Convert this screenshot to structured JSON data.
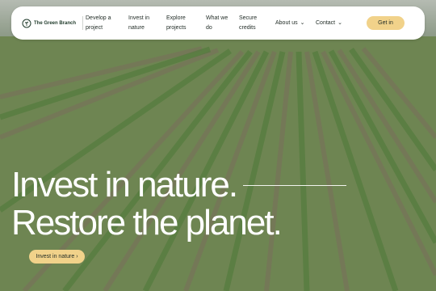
{
  "nav": {
    "brand": "The Green Branch",
    "items": [
      {
        "line1": "Develop a",
        "line2": "project"
      },
      {
        "line1": "Invest in",
        "line2": "nature"
      },
      {
        "line1": "Explore",
        "line2": "projects"
      },
      {
        "line1": "What we",
        "line2": "do"
      },
      {
        "line1": "Secure",
        "line2": "credits"
      }
    ],
    "about": "About us",
    "contact": "Contact",
    "cta": "Get in"
  },
  "hero": {
    "line1": "Invest in nature.",
    "line2": "Restore the planet.",
    "button": "Invest in nature ›"
  },
  "colors": {
    "accent": "#f1d28a",
    "brand": "#1f3a2a"
  }
}
